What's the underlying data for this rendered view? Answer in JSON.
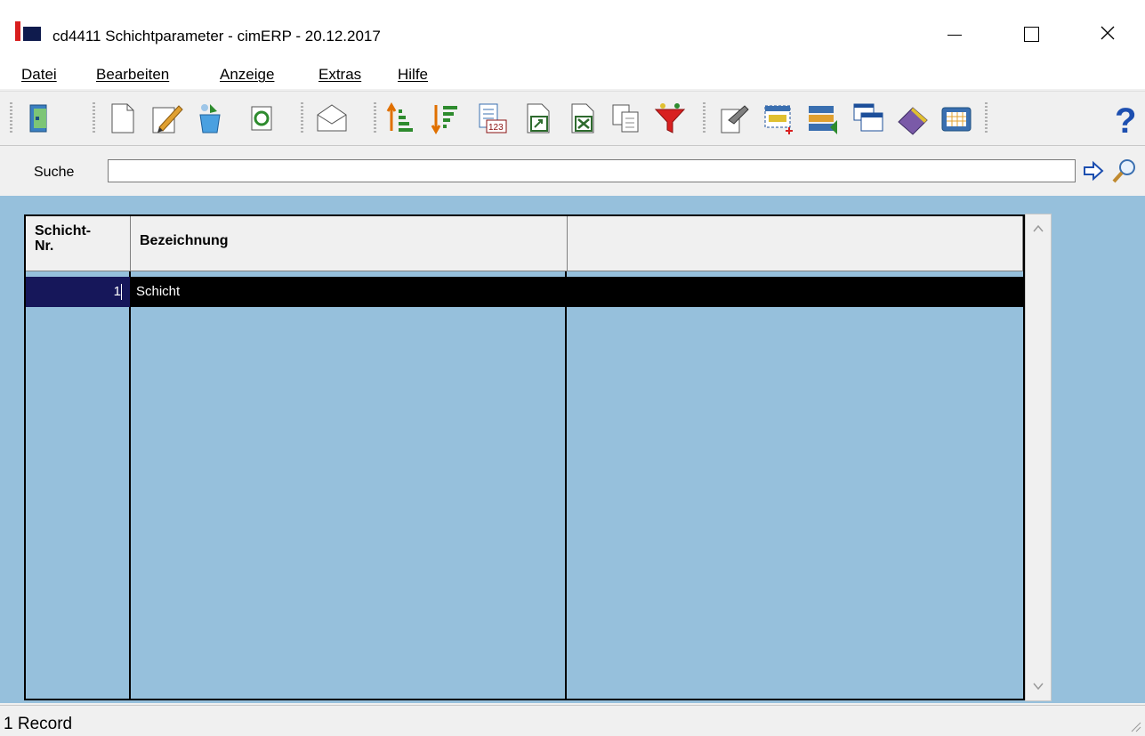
{
  "window": {
    "title": "cd4411 Schichtparameter - cimERP - 20.12.2017",
    "controls": {
      "minimize": "minimize",
      "maximize": "maximize",
      "close": "close"
    }
  },
  "menu": [
    {
      "label": "Datei"
    },
    {
      "label": "Bearbeiten"
    },
    {
      "label": "Anzeige"
    },
    {
      "label": "Extras"
    },
    {
      "label": "Hilfe"
    }
  ],
  "toolbar": {
    "icons": [
      "exit-door-icon",
      "new-document-icon",
      "edit-pencil-icon",
      "save-bucket-icon",
      "refresh-icon",
      "mail-envelope-icon",
      "sort-ascending-icon",
      "sort-descending-icon",
      "number-format-icon",
      "export-icon",
      "excel-export-icon",
      "copy-icon",
      "filter-funnel-icon",
      "properties-icon",
      "new-window-icon",
      "transfer-icon",
      "windows-icon",
      "help-book-icon",
      "calculator-grid-icon",
      "help-question-icon"
    ]
  },
  "search": {
    "label": "Suche",
    "value": "",
    "placeholder": ""
  },
  "grid": {
    "columns": [
      {
        "header_line1": "Schicht-",
        "header_line2": "Nr."
      },
      {
        "header": "Bezeichnung"
      },
      {
        "header": ""
      }
    ],
    "rows": [
      {
        "nr": "1",
        "bezeichnung": "Schicht",
        "extra": ""
      }
    ]
  },
  "status": {
    "text": "1 Record"
  },
  "colors": {
    "grid_bg": "#96c0dc",
    "selected_row": "#000000",
    "selected_key_cell": "#16175a",
    "logo_red": "#d81e1e",
    "logo_navy": "#0f1b4d"
  }
}
